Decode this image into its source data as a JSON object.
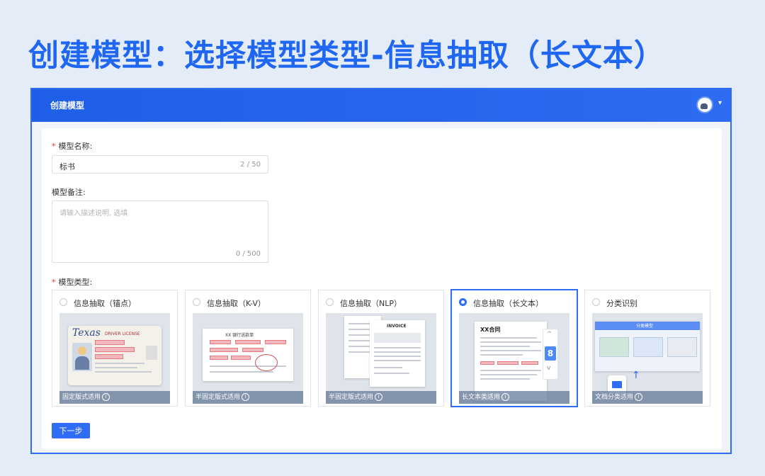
{
  "headline": "创建模型：选择模型类型-信息抽取（长文本）",
  "topbar": {
    "title": "创建模型"
  },
  "form": {
    "name_label": "模型名称:",
    "name_value": "标书",
    "name_count": "2 / 50",
    "note_label": "模型备注:",
    "note_placeholder": "请输入描述说明, 选填",
    "note_count": "0 / 500",
    "type_label": "模型类型:"
  },
  "cards": [
    {
      "name": "信息抽取（锚点）",
      "caption": "固定版式适用",
      "selected": false,
      "thumb_text": [
        "Texas",
        "DRIVER LICENSE"
      ]
    },
    {
      "name": "信息抽取（K-V）",
      "caption": "半固定版式适用",
      "selected": false,
      "thumb_text": [
        "XX 银行送款单"
      ]
    },
    {
      "name": "信息抽取（NLP）",
      "caption": "半固定版式适用",
      "selected": false,
      "thumb_text": [
        "INVOICE"
      ]
    },
    {
      "name": "信息抽取（长文本）",
      "caption": "长文本类适用",
      "selected": true,
      "thumb_text": [
        "XX合同",
        "8"
      ]
    },
    {
      "name": "分类识别",
      "caption": "文档分类适用",
      "selected": false,
      "thumb_text": [
        "分类模型"
      ]
    }
  ],
  "next_button": "下一步",
  "colors": {
    "accent": "#2f6df4",
    "headline": "#1f66f2",
    "required": "#e33333"
  }
}
